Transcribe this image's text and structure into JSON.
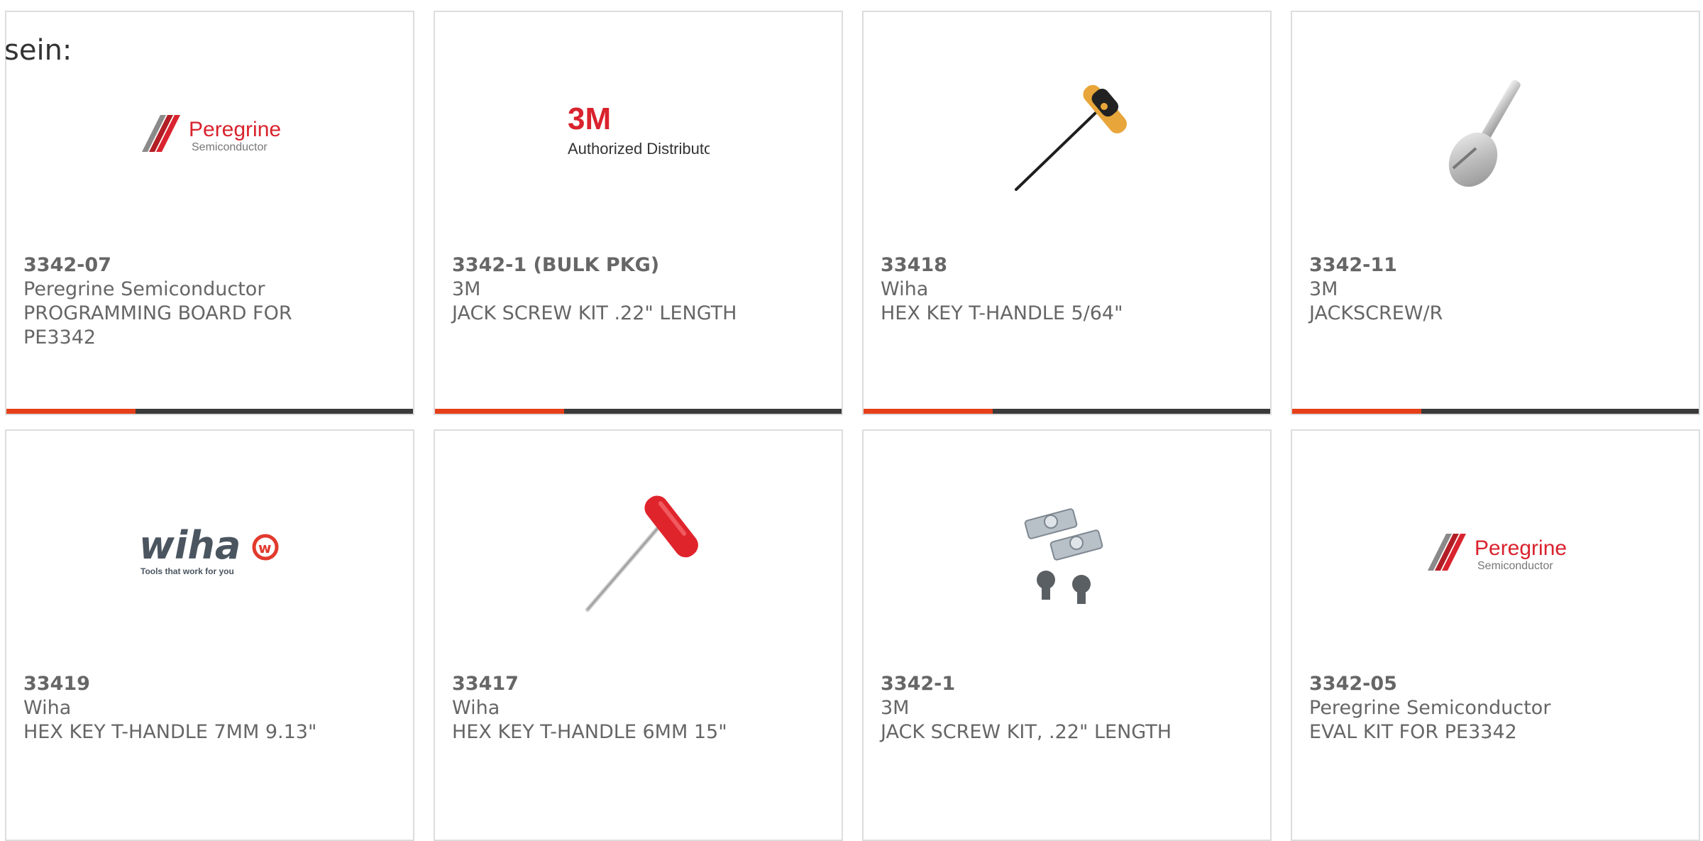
{
  "intro_text": "sein:",
  "colors": {
    "accent": "#e5401a",
    "bar": "#3a3a3a",
    "peregrine_red": "#d9232e",
    "wiha_red": "#e23a2e"
  },
  "products": [
    {
      "part": "3342-07",
      "maker": "Peregrine Semiconductor",
      "desc": "PROGRAMMING BOARD FOR PE3342",
      "image": "peregrine-logo",
      "logo": {
        "name": "Peregrine",
        "sub": "Semiconductor"
      }
    },
    {
      "part": "3342-1 (BULK PKG)",
      "maker": "3M",
      "desc": "JACK SCREW KIT .22\" LENGTH",
      "image": "3m-logo",
      "logo": {
        "name": "3M",
        "sub": "Authorized Distributor"
      }
    },
    {
      "part": "33418",
      "maker": "Wiha",
      "desc": "HEX KEY T-HANDLE 5/64\"",
      "image": "hex-key-photo"
    },
    {
      "part": "3342-11",
      "maker": "3M",
      "desc": "JACKSCREW/R",
      "image": "jackscrew-photo"
    },
    {
      "part": "33419",
      "maker": "Wiha",
      "desc": "HEX KEY T-HANDLE 7MM 9.13\"",
      "image": "wiha-logo",
      "logo": {
        "name": "wiha",
        "sub": "Tools that work for you"
      }
    },
    {
      "part": "33417",
      "maker": "Wiha",
      "desc": "HEX KEY T-HANDLE 6MM 15\"",
      "image": "red-hex-key-photo"
    },
    {
      "part": "3342-1",
      "maker": "3M",
      "desc": "JACK SCREW KIT, .22\" LENGTH",
      "image": "jack-screw-kit-photo"
    },
    {
      "part": "3342-05",
      "maker": "Peregrine Semiconductor",
      "desc": "EVAL KIT FOR PE3342",
      "image": "peregrine-logo",
      "logo": {
        "name": "Peregrine",
        "sub": "Semiconductor"
      }
    }
  ]
}
